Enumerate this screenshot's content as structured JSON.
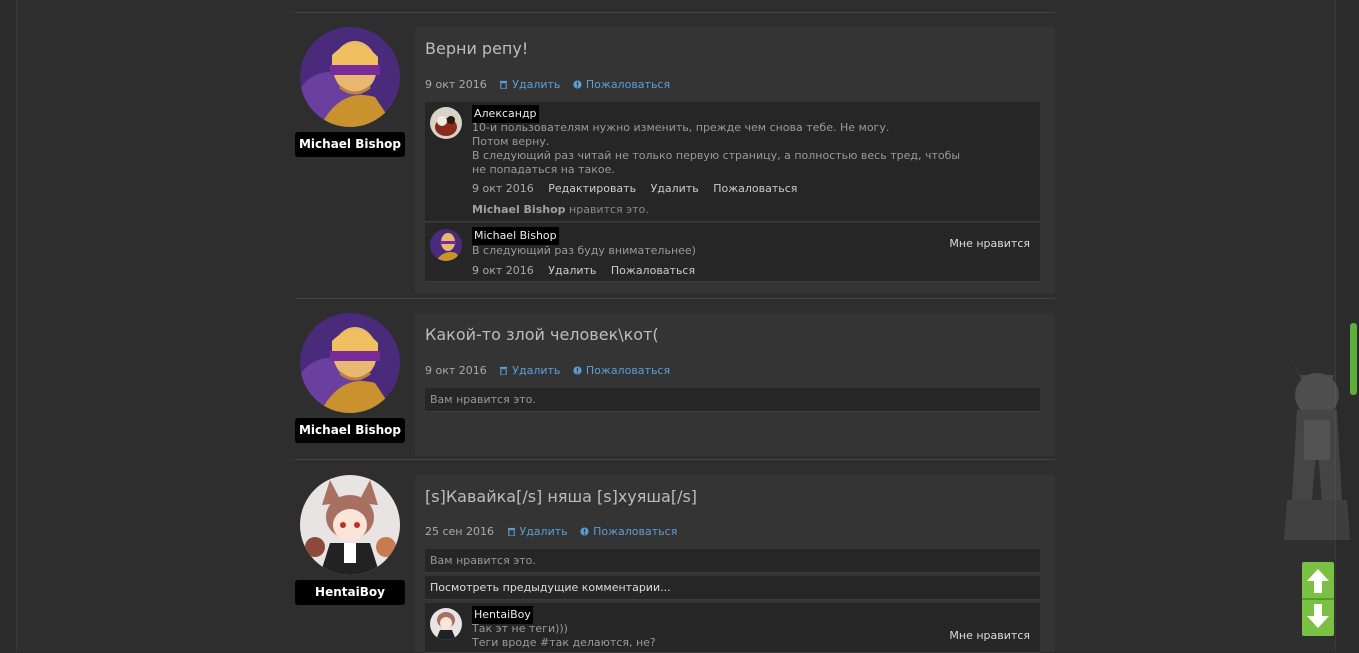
{
  "posts": [
    {
      "author": "Michael Bishop",
      "title": "Верни репу!",
      "date": "9 окт 2016",
      "delete": "Удалить",
      "report": "Пожаловаться",
      "comments": [
        {
          "author": "Александр",
          "lines": [
            "10-и пользователям нужно изменить, прежде чем снова тебе. Не могу.",
            "Потом верну.",
            "В следующий раз читай не только первую страницу, а полностью весь тред, чтобы",
            "не попадаться на такое."
          ],
          "date": "9 окт 2016",
          "edit": "Редактировать",
          "delete": "Удалить",
          "report": "Пожаловаться",
          "liked_by": "Michael Bishop",
          "likes_suffix": "нравится это."
        },
        {
          "author": "Michael Bishop",
          "lines": [
            "В следующий раз буду внимательнее)"
          ],
          "date": "9 окт 2016",
          "delete": "Удалить",
          "report": "Пожаловаться",
          "like_button": "Мне нравится"
        }
      ]
    },
    {
      "author": "Michael Bishop",
      "title": "Какой-то злой человек\\кот(",
      "date": "9 окт 2016",
      "delete": "Удалить",
      "report": "Пожаловаться",
      "likes_text": "Вам нравится это."
    },
    {
      "author": "HentaiBoy",
      "title": "[s]Кавайка[/s] няша [s]хуяша[/s]",
      "date": "25 сен 2016",
      "delete": "Удалить",
      "report": "Пожаловаться",
      "likes_text": "Вам нравится это.",
      "more_comments": "Посмотреть предыдущие комментарии...",
      "comments": [
        {
          "author": "HentaiBoy",
          "lines": [
            "Так эт не теги)))",
            "Теги вроде #так делаются, не?"
          ],
          "like_button": "Мне нравится"
        }
      ]
    }
  ],
  "colors": {
    "link": "#5a9fd6",
    "accent": "#7ac143",
    "background": "#2b2b2b"
  },
  "icons": {
    "delete": "trash-icon",
    "report": "alert-icon",
    "scroll_up": "arrow-up-icon",
    "scroll_down": "arrow-down-icon"
  }
}
